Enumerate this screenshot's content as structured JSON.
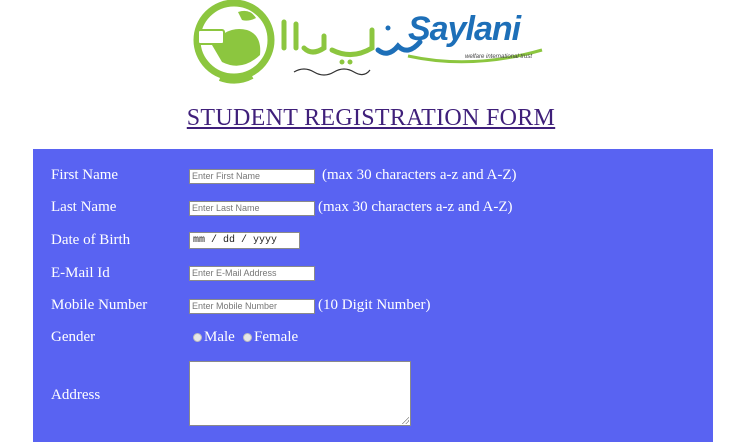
{
  "logo": {
    "brand": "Saylani",
    "subtitle": "welfare international trust"
  },
  "page_title": "STUDENT REGISTRATION FORM",
  "form": {
    "first_name": {
      "label": "First Name",
      "placeholder": "Enter First Name",
      "hint": "(max 30 characters a-z and A-Z)"
    },
    "last_name": {
      "label": "Last Name",
      "placeholder": "Enter Last Name",
      "hint": "(max 30 characters a-z and A-Z)"
    },
    "dob": {
      "label": "Date of Birth",
      "placeholder": "mm / dd / yyyy"
    },
    "email": {
      "label": "E-Mail Id",
      "placeholder": "Enter E-Mail Address"
    },
    "mobile": {
      "label": "Mobile Number",
      "placeholder": "Enter Mobile Number",
      "hint": "(10 Digit Number)"
    },
    "gender": {
      "label": "Gender",
      "options": [
        "Male",
        "Female"
      ]
    },
    "address": {
      "label": "Address"
    }
  },
  "colors": {
    "panel": "#5963f2",
    "title": "#3f1f7a",
    "brand_blue": "#1d6fb8",
    "brand_green": "#8cc63f"
  }
}
